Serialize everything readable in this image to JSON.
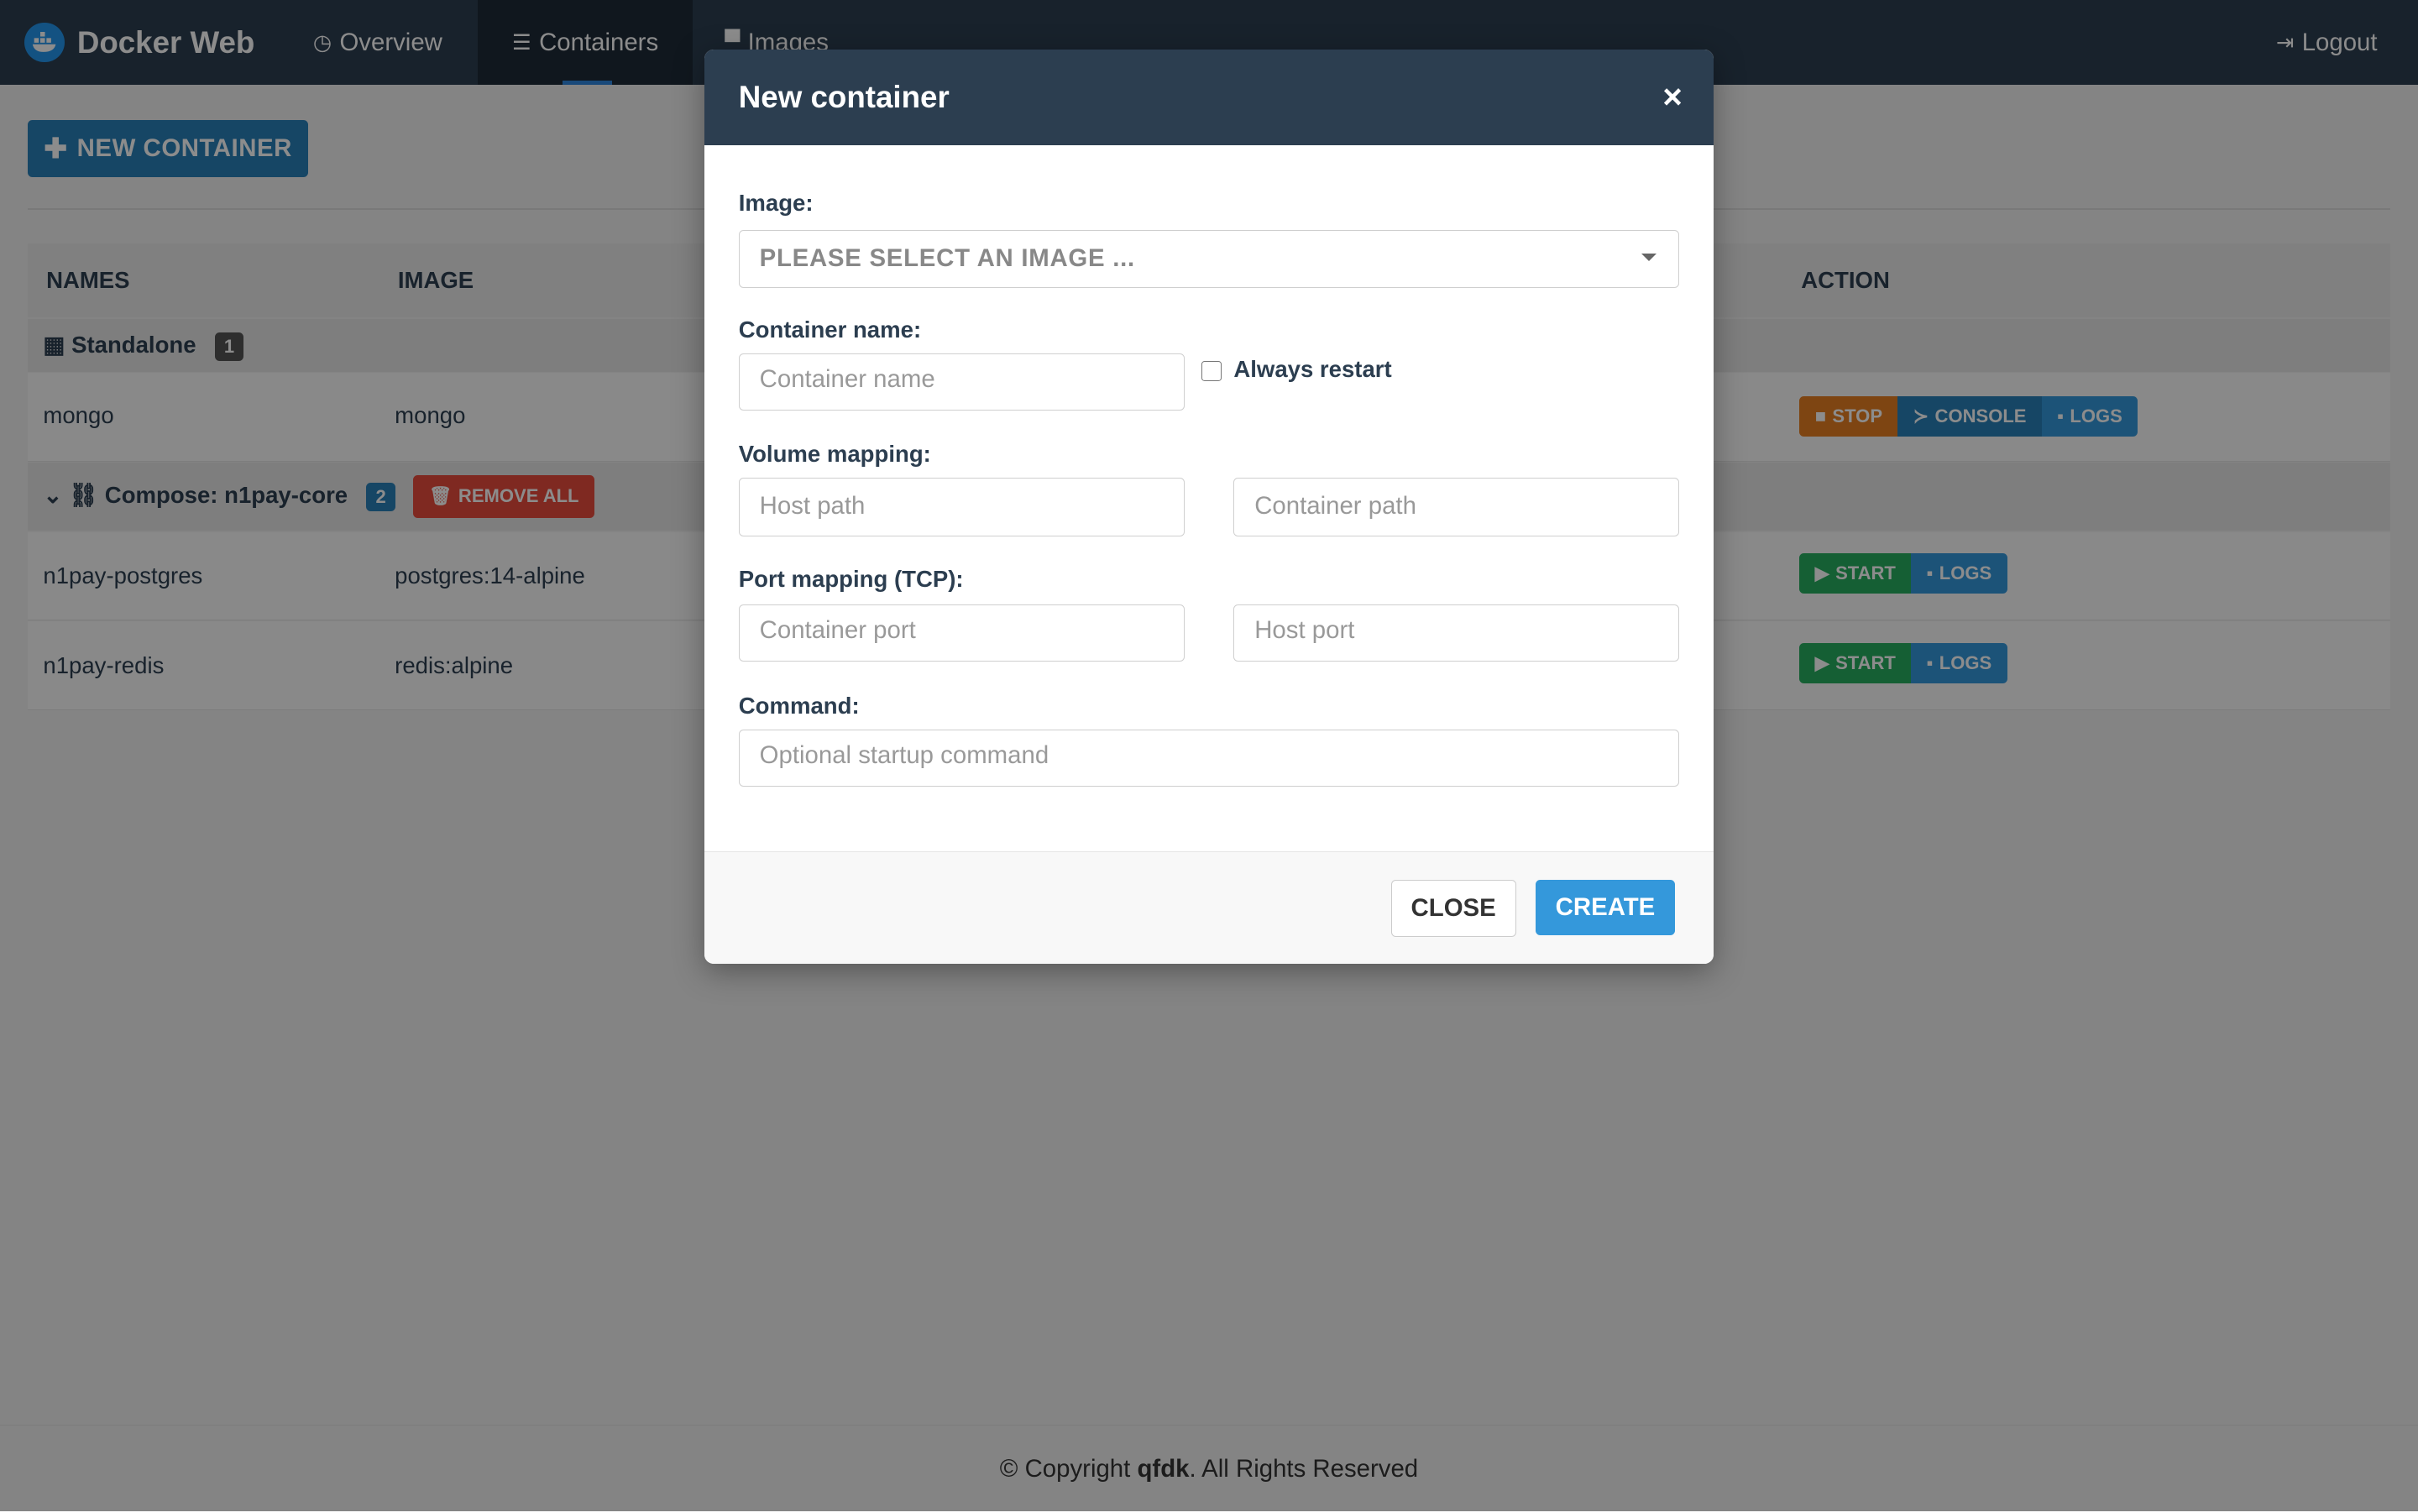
{
  "navbar": {
    "brand": "Docker Web",
    "items": [
      {
        "label": "Overview",
        "icon": "dashboard-icon"
      },
      {
        "label": "Containers",
        "icon": "list-icon"
      },
      {
        "label": "Images",
        "icon": "image-icon"
      }
    ],
    "logout": "Logout"
  },
  "toolbar": {
    "new_container": "NEW CONTAINER"
  },
  "table": {
    "headers": [
      "NAMES",
      "IMAGE",
      "ACTION"
    ],
    "groups": [
      {
        "label": "Standalone",
        "count": "1",
        "rows": [
          {
            "name": "mongo",
            "image": "mongo",
            "actions": [
              "STOP",
              "CONSOLE",
              "LOGS"
            ]
          }
        ]
      },
      {
        "label": "Compose: n1pay-core",
        "count": "2",
        "remove_label": "REMOVE ALL",
        "rows": [
          {
            "name": "n1pay-postgres",
            "image": "postgres:14-alpine",
            "actions": [
              "START",
              "LOGS"
            ]
          },
          {
            "name": "n1pay-redis",
            "image": "redis:alpine",
            "actions": [
              "START",
              "LOGS"
            ]
          }
        ]
      }
    ]
  },
  "footer": {
    "prefix": "© Copyright ",
    "author": "qfdk",
    "suffix": ". All Rights Reserved"
  },
  "modal": {
    "title": "New container",
    "image_label": "Image:",
    "image_select": "PLEASE SELECT AN IMAGE ...",
    "name_label": "Container name:",
    "name_placeholder": "Container name",
    "always_restart": "Always restart",
    "volume_label": "Volume mapping:",
    "host_path_placeholder": "Host path",
    "container_path_placeholder": "Container path",
    "port_label": "Port mapping (TCP):",
    "container_port_placeholder": "Container port",
    "host_port_placeholder": "Host port",
    "command_label": "Command:",
    "command_placeholder": "Optional startup command",
    "close_label": "CLOSE",
    "create_label": "CREATE"
  },
  "colors": {
    "navbar": "#2c3e50",
    "primary": "#2980b9",
    "warning": "#e67e22",
    "success": "#27ae60",
    "info": "#3498db",
    "danger": "#e74c3c"
  }
}
